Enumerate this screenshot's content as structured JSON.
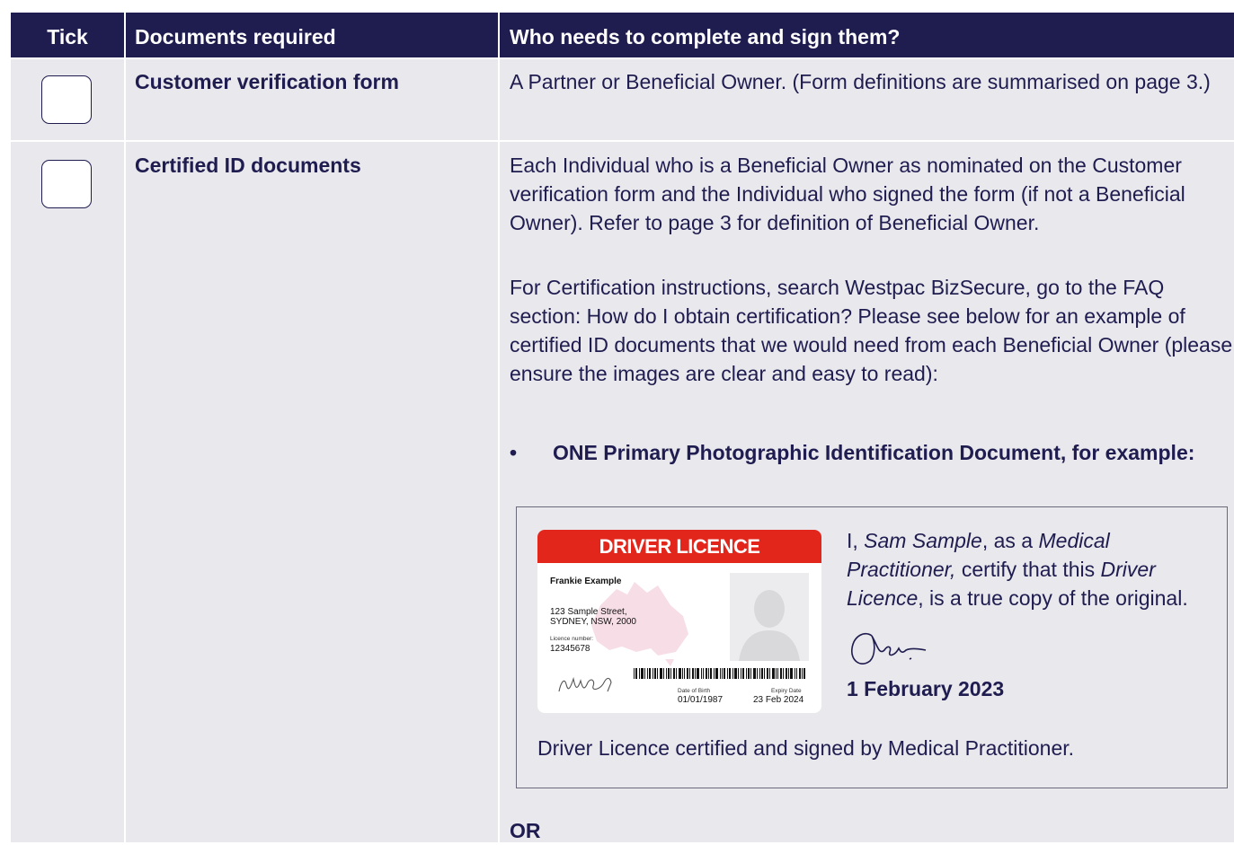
{
  "header": {
    "tick": "Tick",
    "documents": "Documents required",
    "who": "Who needs to complete and sign them?"
  },
  "rows": [
    {
      "document": "Customer verification form",
      "who": "A Partner or Beneficial Owner. (Form definitions are summarised on page 3.)"
    },
    {
      "document": "Certified ID documents",
      "who_para1": "Each Individual who is a Beneficial Owner as nominated on the Customer verification form and the Individual who signed the form (if not a Beneficial Owner).  Refer to page 3 for definition of Beneficial Owner.",
      "who_para2": "For Certification instructions, search Westpac BizSecure, go to the FAQ section: How do I obtain certification? Please see below for an example of certified ID documents that we would need from each Beneficial Owner (please ensure the images are clear and easy to read):",
      "bullet": "ONE Primary Photographic Identification Document, for example:"
    }
  ],
  "example": {
    "card": {
      "title": "DRIVER LICENCE",
      "name": "Frankie Example",
      "address_line1": "123 Sample Street,",
      "address_line2": "SYDNEY, NSW, 2000",
      "licence_label": "Licence number:",
      "licence_number": "12345678",
      "dob_label": "Date of Birth",
      "dob": "01/01/1987",
      "expiry_label": "Expiry Date",
      "expiry": "23 Feb 2024",
      "band_color": "#e3261c"
    },
    "cert_i": "I, ",
    "cert_name": "Sam Sample",
    "cert_as": ", as a ",
    "cert_role": "Medical Practitioner,",
    "cert_mid": " certify that this ",
    "cert_doc": "Driver Licence",
    "cert_end": ", is a true copy of the original.",
    "date": "1 February 2023",
    "caption": "Driver Licence certified and signed by Medical Practitioner."
  },
  "or_text": "OR",
  "colors": {
    "navy": "#1f1c4f",
    "panel": "#e8e8ed",
    "red": "#e3261c"
  }
}
